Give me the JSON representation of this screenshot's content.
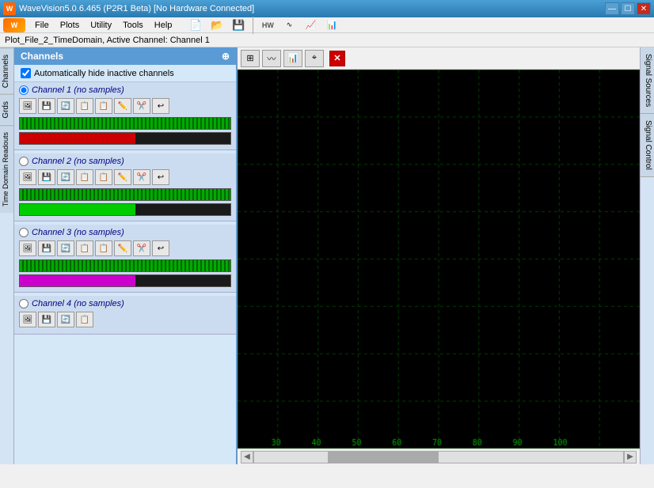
{
  "window": {
    "title": "WaveVision5.0.6.465 (P2R1 Beta)  [No Hardware Connected]",
    "titlebar_controls": [
      "—",
      "☐",
      "✕"
    ]
  },
  "menu": {
    "items": [
      "File",
      "Plots",
      "Utility",
      "Tools",
      "Help"
    ]
  },
  "statusbar_top": {
    "text": "Plot_File_2_TimeDomain,  Active Channel: Channel 1"
  },
  "channels_panel": {
    "title": "Channels",
    "pin_label": "↑",
    "auto_hide_label": "Automatically hide inactive channels",
    "channels": [
      {
        "id": 1,
        "title": "Channel 1 (no samples)",
        "color": "#cc0000"
      },
      {
        "id": 2,
        "title": "Channel 2 (no samples)",
        "color": "#00cc00"
      },
      {
        "id": 3,
        "title": "Channel 3 (no samples)",
        "color": "#cc00cc"
      },
      {
        "id": 4,
        "title": "Channel 4 (no samples)",
        "color": "#0000cc"
      }
    ],
    "channel_toolbar_icons": [
      "📋",
      "💾",
      "🔄",
      "📋",
      "📋",
      "✏️",
      "✂️",
      "↩️"
    ]
  },
  "left_tabs": [
    "Channels",
    "Grds",
    "Time Domain Readouts"
  ],
  "right_tabs": [
    "Signal Sources",
    "Signal Control"
  ],
  "plot": {
    "x_labels": [
      "30",
      "40",
      "50",
      "60",
      "70",
      "80",
      "90",
      "100"
    ],
    "close_label": "✕"
  }
}
